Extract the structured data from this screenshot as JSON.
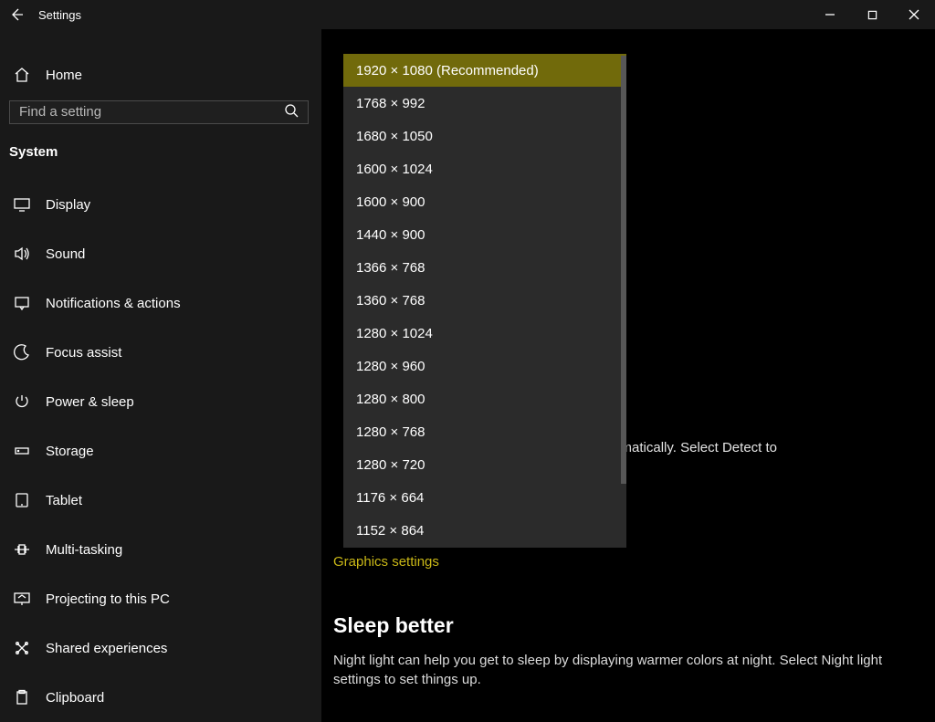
{
  "titlebar": {
    "title": "Settings"
  },
  "nav": {
    "home_label": "Home",
    "search_placeholder": "Find a setting",
    "section_title": "System",
    "items": [
      {
        "icon": "display",
        "label": "Display"
      },
      {
        "icon": "sound",
        "label": "Sound"
      },
      {
        "icon": "notifications",
        "label": "Notifications & actions"
      },
      {
        "icon": "focus",
        "label": "Focus assist"
      },
      {
        "icon": "power",
        "label": "Power & sleep"
      },
      {
        "icon": "storage",
        "label": "Storage"
      },
      {
        "icon": "tablet",
        "label": "Tablet"
      },
      {
        "icon": "multitask",
        "label": "Multi-tasking"
      },
      {
        "icon": "project",
        "label": "Projecting to this PC"
      },
      {
        "icon": "shared",
        "label": "Shared experiences"
      },
      {
        "icon": "clipboard",
        "label": "Clipboard"
      }
    ]
  },
  "dropdown": {
    "options": [
      "1920 × 1080 (Recommended)",
      "1768 × 992",
      "1680 × 1050",
      "1600 × 1024",
      "1600 × 900",
      "1440 × 900",
      "1366 × 768",
      "1360 × 768",
      "1280 × 1024",
      "1280 × 960",
      "1280 × 800",
      "1280 × 768",
      "1280 × 720",
      "1176 × 664",
      "1152 × 864"
    ],
    "selected_index": 0
  },
  "main": {
    "partial_text": "matically. Select Detect to",
    "graphics_link": "Graphics settings",
    "sleep_heading": "Sleep better",
    "sleep_body": "Night light can help you get to sleep by displaying warmer colors at night. Select Night light settings to set things up."
  }
}
